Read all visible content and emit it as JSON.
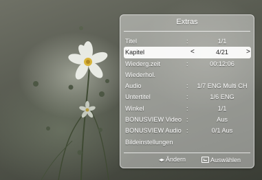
{
  "panel": {
    "title": "Extras",
    "rows": [
      {
        "label": "Titel",
        "colon": ":",
        "value": "1/1"
      },
      {
        "label": "Kapitel",
        "colon": ":",
        "value": "4/21",
        "arrow_left": "<",
        "arrow_right": ">"
      },
      {
        "label": "Wiederg.zeit",
        "colon": ":",
        "value": "00:12:06"
      },
      {
        "label": "Wiederhol.",
        "colon": "",
        "value": ""
      },
      {
        "label": "Audio",
        "colon": ":",
        "value": "1/7 ENG Multi CH"
      },
      {
        "label": "Untertitel",
        "colon": ":",
        "value": "1/6 ENG"
      },
      {
        "label": "Winkel",
        "colon": ":",
        "value": "1/1"
      },
      {
        "label": "BONUSVIEW Video",
        "colon": ":",
        "value": "Aus"
      },
      {
        "label": "BONUSVIEW Audio",
        "colon": ":",
        "value": "0/1 Aus"
      },
      {
        "label": "Bildeinstellungen",
        "colon": "",
        "value": ""
      }
    ],
    "selected_index": 1
  },
  "footer": {
    "change_icon": "left-right-arrows-icon",
    "change_glyph": "◂▸",
    "change_label": "Ändern",
    "select_icon": "enter-icon",
    "select_label": "Auswählen"
  },
  "colors": {
    "panel_bg": "#ffffff6b",
    "selected_bg": "#ffffffeb",
    "text": "#ffffff",
    "selected_text": "#222222"
  }
}
